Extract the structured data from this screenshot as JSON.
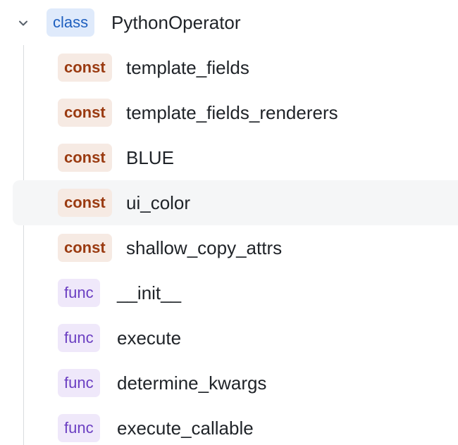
{
  "root": {
    "kind": "class",
    "name": "PythonOperator",
    "expanded": true
  },
  "members": [
    {
      "kind": "const",
      "name": "template_fields"
    },
    {
      "kind": "const",
      "name": "template_fields_renderers"
    },
    {
      "kind": "const",
      "name": "BLUE"
    },
    {
      "kind": "const",
      "name": "ui_color",
      "selected": true
    },
    {
      "kind": "const",
      "name": "shallow_copy_attrs"
    },
    {
      "kind": "func",
      "name": "__init__"
    },
    {
      "kind": "func",
      "name": "execute"
    },
    {
      "kind": "func",
      "name": "determine_kwargs"
    },
    {
      "kind": "func",
      "name": "execute_callable"
    }
  ],
  "icons": {
    "expand": "chevron-down-icon"
  },
  "colors": {
    "class_badge_bg": "#dfeafb",
    "class_badge_text": "#1e5fbf",
    "const_badge_bg": "#f6eae3",
    "const_badge_text": "#9a3a10",
    "func_badge_bg": "#efe8fa",
    "func_badge_text": "#6b3fc2",
    "selected_row_bg": "#f5f6f7"
  }
}
